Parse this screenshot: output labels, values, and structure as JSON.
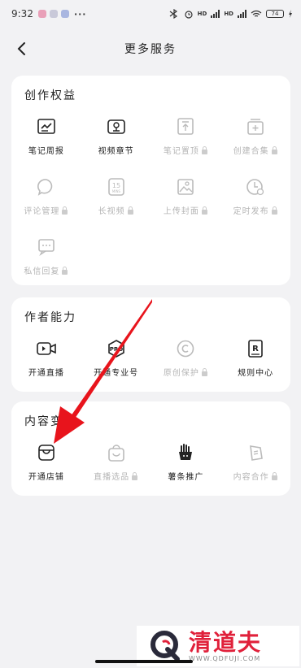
{
  "status_bar": {
    "time": "9:32",
    "dots": "···",
    "signal_label_1": "HD",
    "signal_label_2": "HD",
    "battery": "74"
  },
  "nav": {
    "title": "更多服务"
  },
  "sections": [
    {
      "title": "创作权益",
      "items": [
        {
          "label": "笔记周报",
          "icon": "report-chart-icon",
          "locked": false
        },
        {
          "label": "视频章节",
          "icon": "video-chapter-icon",
          "locked": false
        },
        {
          "label": "笔记置顶",
          "icon": "pin-top-icon",
          "locked": true
        },
        {
          "label": "创建合集",
          "icon": "collection-add-icon",
          "locked": true
        },
        {
          "label": "评论管理",
          "icon": "comment-icon",
          "locked": true
        },
        {
          "label": "长视频",
          "icon": "long-video-15min-icon",
          "locked": true
        },
        {
          "label": "上传封面",
          "icon": "image-upload-icon",
          "locked": true
        },
        {
          "label": "定时发布",
          "icon": "clock-schedule-icon",
          "locked": true
        },
        {
          "label": "私信回复",
          "icon": "message-reply-icon",
          "locked": true
        }
      ]
    },
    {
      "title": "作者能力",
      "items": [
        {
          "label": "开通直播",
          "icon": "live-camera-icon",
          "locked": false
        },
        {
          "label": "开通专业号",
          "icon": "pro-badge-icon",
          "locked": false
        },
        {
          "label": "原创保护",
          "icon": "copyright-icon",
          "locked": true
        },
        {
          "label": "规则中心",
          "icon": "rules-book-icon",
          "locked": false
        }
      ]
    },
    {
      "title": "内容变现",
      "items": [
        {
          "label": "开通店铺",
          "icon": "store-icon",
          "locked": false
        },
        {
          "label": "直播选品",
          "icon": "shopping-bag-icon",
          "locked": true
        },
        {
          "label": "薯条推广",
          "icon": "fries-promo-icon",
          "locked": false
        },
        {
          "label": "内容合作",
          "icon": "cooperation-icon",
          "locked": true
        }
      ]
    }
  ],
  "watermark": {
    "name": "清道夫",
    "url": "WWW.QDFUJI.COM"
  },
  "colors": {
    "background": "#f2f2f4",
    "card": "#ffffff",
    "locked_text": "#b5b5b5",
    "arrow": "#e8141c",
    "watermark_red": "#e0203a"
  }
}
